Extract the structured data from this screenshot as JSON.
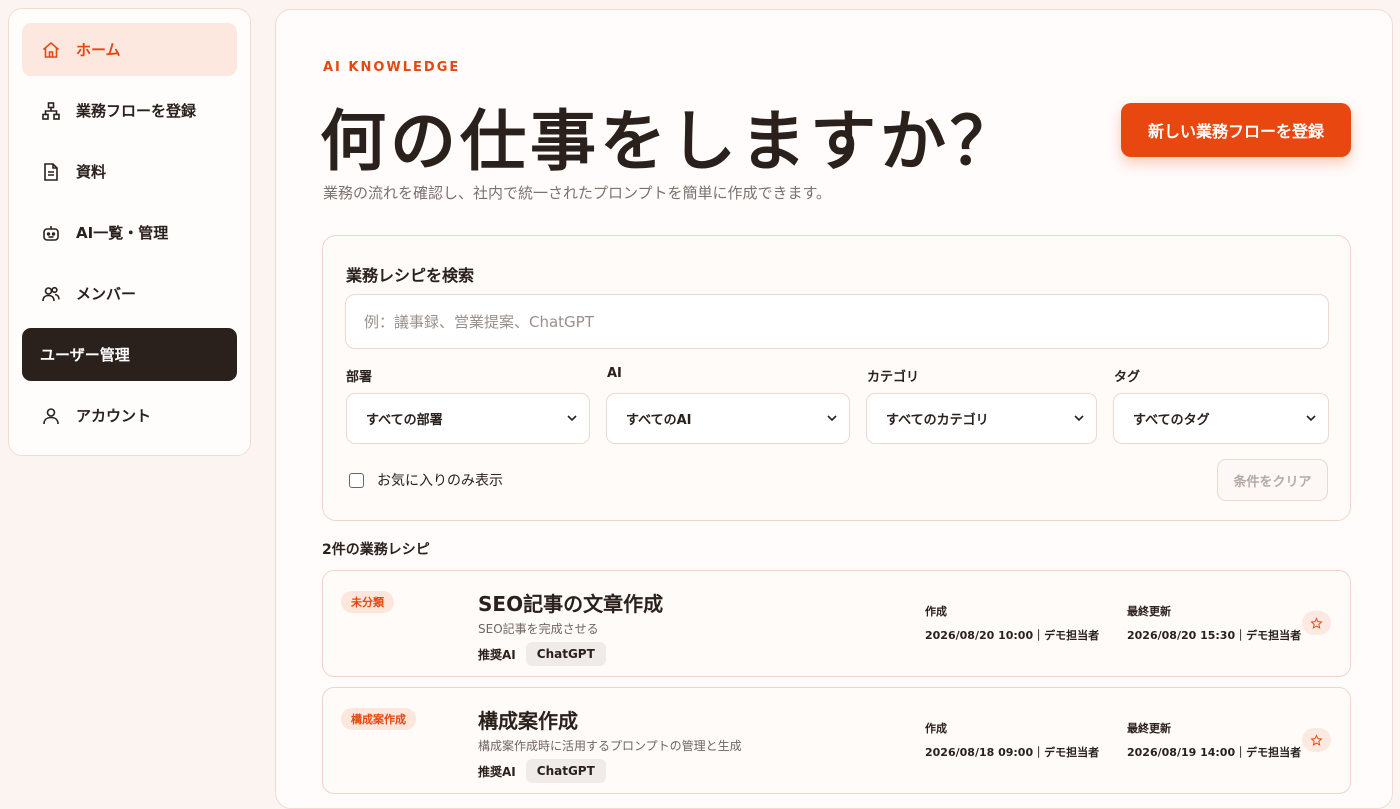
{
  "sidebar": {
    "items": [
      {
        "label": "ホーム",
        "icon": "home-icon",
        "state": "active"
      },
      {
        "label": "業務フローを登録",
        "icon": "flow-icon",
        "state": "normal"
      },
      {
        "label": "資料",
        "icon": "document-icon",
        "state": "normal"
      },
      {
        "label": "AI一覧・管理",
        "icon": "robot-icon",
        "state": "normal"
      },
      {
        "label": "メンバー",
        "icon": "users-icon",
        "state": "normal"
      },
      {
        "label": "ユーザー管理",
        "icon": "",
        "state": "dark"
      },
      {
        "label": "アカウント",
        "icon": "user-icon",
        "state": "normal"
      }
    ]
  },
  "header": {
    "eyebrow": "AI KNOWLEDGE",
    "title": "何の仕事をしますか？",
    "subtitle": "業務の流れを確認し、社内で統一されたプロンプトを簡単に作成できます。",
    "new_flow_button": "新しい業務フローを登録"
  },
  "search": {
    "title": "業務レシピを検索",
    "placeholder": "例：議事録、営業提案、ChatGPT",
    "filters": [
      {
        "label": "部署",
        "value": "すべての部署"
      },
      {
        "label": "AI",
        "value": "すべてのAI"
      },
      {
        "label": "カテゴリ",
        "value": "すべてのカテゴリ"
      },
      {
        "label": "タグ",
        "value": "すべてのタグ"
      }
    ],
    "favorites_label": "お気に入りのみ表示",
    "clear_button": "条件をクリア"
  },
  "results": {
    "count_label": "2件の業務レシピ",
    "recipes": [
      {
        "category": "未分類",
        "title": "SEO記事の文章作成",
        "description": "SEO記事を完成させる",
        "ai_label": "推奨AI",
        "ai": "ChatGPT",
        "created_label": "作成",
        "created": "2026/08/20 10:00｜デモ担当者",
        "updated_label": "最終更新",
        "updated": "2026/08/20 15:30｜デモ担当者"
      },
      {
        "category": "構成案作成",
        "title": "構成案作成",
        "description": "構成案作成時に活用するプロンプトの管理と生成",
        "ai_label": "推奨AI",
        "ai": "ChatGPT",
        "created_label": "作成",
        "created": "2026/08/18 09:00｜デモ担当者",
        "updated_label": "最終更新",
        "updated": "2026/08/19 14:00｜デモ担当者"
      }
    ]
  },
  "colors": {
    "accent": "#e8470f",
    "dark": "#2b211c",
    "background": "#fbf4f1"
  }
}
